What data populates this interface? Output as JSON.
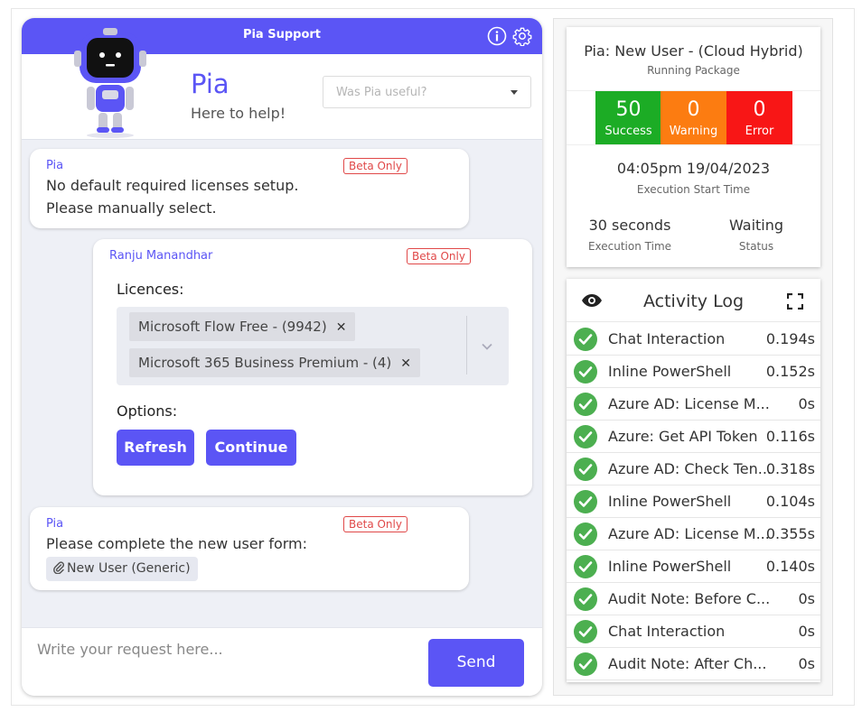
{
  "chat": {
    "header_title": "Pia Support",
    "assistant_name": "Pia",
    "assistant_tagline": "Here to help!",
    "feedback_placeholder": "Was Pia useful?",
    "messages": [
      {
        "sender": "Pia",
        "badge": "Beta Only",
        "lines": [
          "No default required licenses setup.",
          "Please manually select."
        ]
      },
      {
        "sender": "Ranju Manandhar",
        "badge": "Beta Only",
        "licences_label": "Licences:",
        "licences": [
          "Microsoft Flow Free - (9942)",
          "Microsoft 365 Business Premium - (4)"
        ],
        "options_label": "Options:",
        "buttons": [
          "Refresh",
          "Continue"
        ]
      },
      {
        "sender": "Pia",
        "badge": "Beta Only",
        "text": "Please complete the new user form:",
        "attachment": "New User (Generic)"
      }
    ],
    "composer_placeholder": "Write your request here...",
    "send_label": "Send"
  },
  "package": {
    "name": "Pia: New User - (Cloud Hybrid)",
    "subtitle": "Running Package",
    "stats": [
      {
        "value": "50",
        "label": "Success",
        "color": "#1cac25"
      },
      {
        "value": "0",
        "label": "Warning",
        "color": "#fc7c11"
      },
      {
        "value": "0",
        "label": "Error",
        "color": "#f81616"
      }
    ],
    "start_time": "04:05pm 19/04/2023",
    "start_time_label": "Execution Start Time",
    "execution_time": "30 seconds",
    "execution_time_label": "Execution Time",
    "status": "Waiting",
    "status_label": "Status"
  },
  "activity_log": {
    "title": "Activity Log",
    "rows": [
      {
        "name": "Chat Interaction",
        "time": "0.194s"
      },
      {
        "name": "Inline PowerShell",
        "time": "0.152s"
      },
      {
        "name": "Azure AD: License M...",
        "time": "0s"
      },
      {
        "name": "Azure: Get API Token",
        "time": "0.116s"
      },
      {
        "name": "Azure AD: Check Ten...",
        "time": "0.318s"
      },
      {
        "name": "Inline PowerShell",
        "time": "0.104s"
      },
      {
        "name": "Azure AD: License M...",
        "time": "0.355s"
      },
      {
        "name": "Inline PowerShell",
        "time": "0.140s"
      },
      {
        "name": "Audit Note: Before C...",
        "time": "0s"
      },
      {
        "name": "Chat Interaction",
        "time": "0s"
      },
      {
        "name": "Audit Note: After Ch...",
        "time": "0s"
      }
    ]
  },
  "icons": {
    "info": "info-icon",
    "settings": "gear-icon",
    "dropdown": "chevron-down-icon",
    "remove": "close-icon",
    "attachment": "paperclip-icon",
    "view": "eye-icon",
    "fullscreen": "fullscreen-icon",
    "success": "check-circle-icon"
  },
  "colors": {
    "accent": "#5b55f5",
    "success": "#1cac25",
    "warning": "#fc7c11",
    "error": "#f81616",
    "check": "#4caf50",
    "beta": "#e04848"
  }
}
